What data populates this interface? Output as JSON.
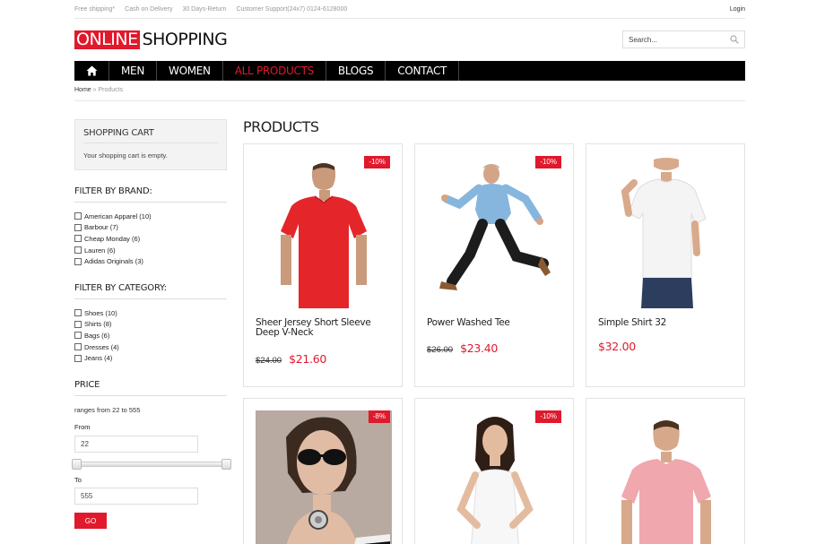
{
  "topbar": {
    "info": [
      "Free shipping*",
      "Cash on Delivery",
      "30 Days-Return",
      "Customer Support(24x7) 0124-6128000"
    ],
    "login": "Login"
  },
  "logo": {
    "part1": "ONLINE",
    "part2": "SHOPPING"
  },
  "search": {
    "placeholder": "Search..."
  },
  "nav": {
    "items": [
      {
        "label": "MEN"
      },
      {
        "label": "WOMEN"
      },
      {
        "label": "ALL PRODUCTS",
        "active": true
      },
      {
        "label": "BLOGS"
      },
      {
        "label": "CONTACT"
      }
    ]
  },
  "breadcrumb": {
    "home": "Home",
    "separator": "»",
    "current": "Products"
  },
  "cart": {
    "title": "SHOPPING CART",
    "empty_text": "Your shopping cart is empty."
  },
  "filters": {
    "brand_title": "FILTER BY BRAND:",
    "brands": [
      "American Apparel (10)",
      "Barbour (7)",
      "Cheap Monday (6)",
      "Lauren (6)",
      "Adidas Originals (3)"
    ],
    "category_title": "FILTER BY CATEGORY:",
    "categories": [
      "Shoes (10)",
      "Shirts (8)",
      "Bags (6)",
      "Dresses (4)",
      "Jeans (4)"
    ]
  },
  "price": {
    "title": "PRICE",
    "range_text": "ranges from 22 to 555",
    "from_label": "From",
    "from_value": "22",
    "to_label": "To",
    "to_value": "555",
    "go_label": "GO"
  },
  "products": {
    "title": "PRODUCTS",
    "items": [
      {
        "name": "Sheer Jersey Short Sleeve Deep V-Neck",
        "old_price": "$24.00",
        "price": "$21.60",
        "badge": "-10%",
        "image": "red-tshirt-man"
      },
      {
        "name": "Power Washed Tee",
        "old_price": "$26.00",
        "price": "$23.40",
        "badge": "-10%",
        "image": "jumping-man"
      },
      {
        "name": "Simple Shirt 32",
        "old_price": "",
        "price": "$32.00",
        "badge": "",
        "image": "white-tshirt-woman"
      },
      {
        "name": "",
        "old_price": "",
        "price": "",
        "badge": "-8%",
        "image": "sunglasses-woman"
      },
      {
        "name": "",
        "old_price": "",
        "price": "",
        "badge": "-10%",
        "image": "white-top-woman"
      },
      {
        "name": "",
        "old_price": "",
        "price": "",
        "badge": "",
        "image": "pink-tshirt-man"
      }
    ]
  },
  "colors": {
    "accent": "#e0192c",
    "nav_bg": "#000000"
  }
}
